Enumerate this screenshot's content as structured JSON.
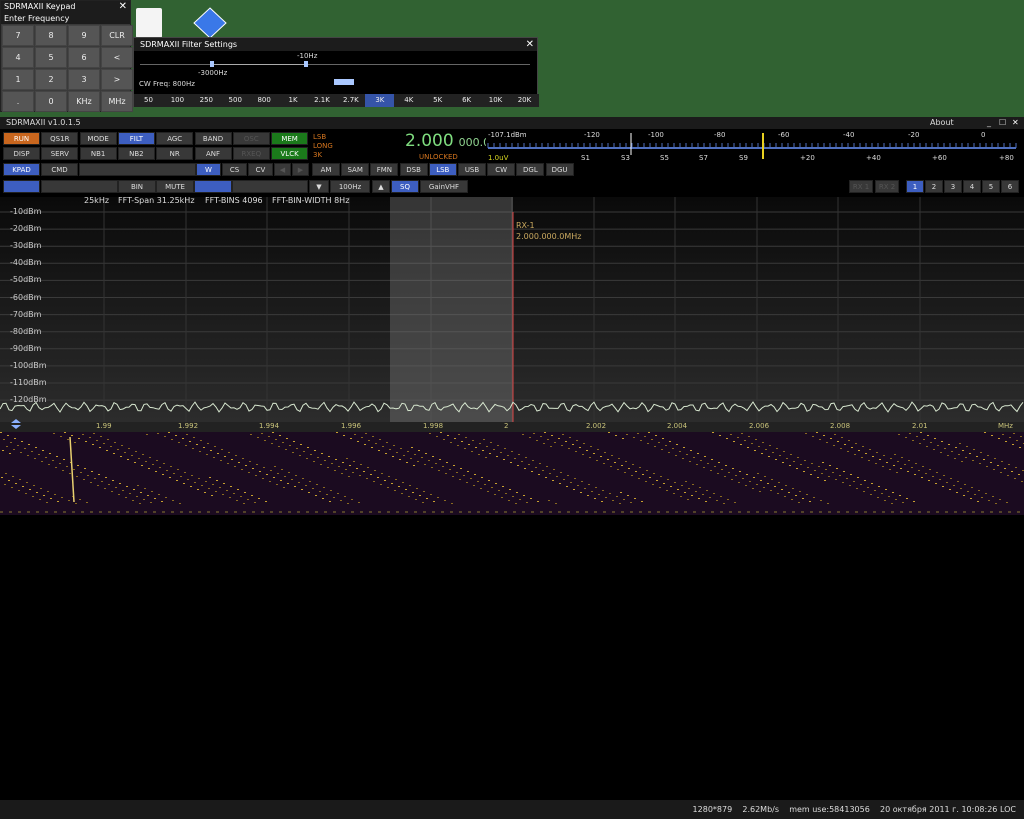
{
  "keypad": {
    "title": "SDRMAXII Keypad",
    "subtitle": "Enter Frequency",
    "keys": [
      "7",
      "8",
      "9",
      "CLR",
      "4",
      "5",
      "6",
      "<",
      "1",
      "2",
      "3",
      ">",
      ".",
      "0",
      "KHz",
      "MHz"
    ]
  },
  "filter": {
    "title": "SDRMAXII Filter Settings",
    "hi_label": "-10Hz",
    "lo_label": "-3000Hz",
    "cw_label": "CW Freq: 800Hz",
    "buttons": [
      "50",
      "100",
      "250",
      "500",
      "800",
      "1K",
      "2.1K",
      "2.7K",
      "3K",
      "4K",
      "5K",
      "6K",
      "10K",
      "20K"
    ],
    "active": "3K"
  },
  "main": {
    "title": "SDRMAXII v1.0.1.5",
    "about": "About",
    "row1": [
      "RUN",
      "QS1R",
      "MODE",
      "FILT",
      "AGC",
      "BAND",
      "OSC",
      "MEM"
    ],
    "row2": [
      "DISP",
      "SERV",
      "NB1",
      "NB2",
      "NR",
      "ANF",
      "RXEQ",
      "VLCK"
    ],
    "row3": [
      "KPAD",
      "CMD"
    ],
    "mode_info": {
      "mode": "LSB",
      "agc": "LONG",
      "filter": "3K"
    },
    "freq": {
      "main": "2.000",
      "sub": "000.0",
      "lock": "UNLOCKED"
    },
    "smeter": {
      "dbm": "-107.1dBm",
      "uv": "1.0uV",
      "top": [
        "-120",
        "-100",
        "-80",
        "-60",
        "-40",
        "-20",
        "0"
      ],
      "bottom": [
        "S1",
        "S3",
        "S5",
        "S7",
        "S9",
        "+20",
        "+40",
        "+60",
        "+80"
      ]
    },
    "small_btns": [
      "W",
      "CS",
      "CV"
    ],
    "modes": [
      "AM",
      "SAM",
      "FMN",
      "DSB",
      "LSB",
      "USB",
      "CW",
      "DGL",
      "DGU"
    ],
    "active_mode": "LSB",
    "bar3": {
      "bin": "BIN",
      "mute": "MUTE",
      "step": "100Hz",
      "sq": "SQ",
      "gain": "GainVHF",
      "rx": [
        "RX 1",
        "RX 2"
      ],
      "nums": [
        "1",
        "2",
        "3",
        "4",
        "5",
        "6"
      ]
    },
    "info": {
      "span": "25kHz",
      "fft_span": "FFT-Span 31.25kHz",
      "bins": "FFT-BINS 4096",
      "width": "FFT-BIN-WIDTH 8Hz"
    },
    "ylabels": [
      "-10dBm",
      "-20dBm",
      "-30dBm",
      "-40dBm",
      "-50dBm",
      "-60dBm",
      "-70dBm",
      "-80dBm",
      "-90dBm",
      "-100dBm",
      "-110dBm",
      "-120dBm"
    ],
    "xlabels": [
      "1.99",
      "1.992",
      "1.994",
      "1.996",
      "1.998",
      "2",
      "2.002",
      "2.004",
      "2.006",
      "2.008",
      "2.01",
      "MHz"
    ],
    "marker": {
      "name": "RX-1",
      "freq": "2.000.000.0MHz"
    }
  },
  "status": {
    "res": "1280*879",
    "rate": "2.62Mb/s",
    "mem": "mem use:58413056",
    "date": "20 октября 2011 г. 10:08:26 LOC"
  }
}
